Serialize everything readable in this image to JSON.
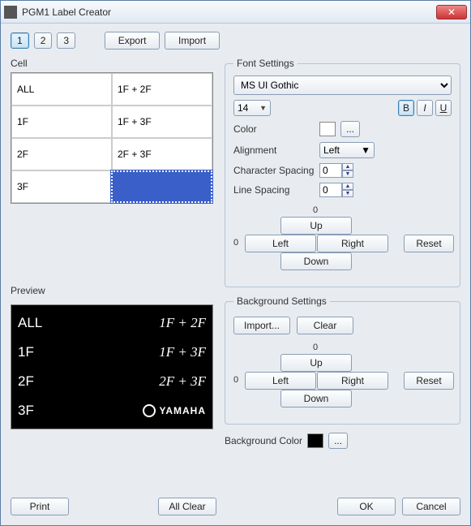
{
  "title": "PGM1 Label Creator",
  "toolbar": {
    "tabs": [
      "1",
      "2",
      "3"
    ],
    "export": "Export",
    "import": "Import"
  },
  "cell": {
    "label": "Cell",
    "rows": [
      [
        "ALL",
        "1F + 2F"
      ],
      [
        "1F",
        "1F + 3F"
      ],
      [
        "2F",
        "2F + 3F"
      ],
      [
        "3F",
        ""
      ]
    ],
    "selected": [
      3,
      1
    ]
  },
  "preview": {
    "label": "Preview",
    "rows": [
      {
        "l": "ALL",
        "r": "1F + 2F"
      },
      {
        "l": "1F",
        "r": "1F + 3F"
      },
      {
        "l": "2F",
        "r": "2F + 3F"
      },
      {
        "l": "3F",
        "r": "@YAMAHA"
      }
    ]
  },
  "font": {
    "legend": "Font Settings",
    "family": "MS UI Gothic",
    "size": "14",
    "bold": "B",
    "italic": "I",
    "underline": "U",
    "color_label": "Color",
    "ellipsis": "...",
    "align_label": "Alignment",
    "align_value": "Left",
    "charspace_label": "Character Spacing",
    "charspace_value": "0",
    "linespace_label": "Line Spacing",
    "linespace_value": "0",
    "dpad": {
      "zero": "0",
      "up": "Up",
      "left": "Left",
      "right": "Right",
      "down": "Down",
      "reset": "Reset"
    }
  },
  "bg": {
    "legend": "Background Settings",
    "import": "Import...",
    "clear": "Clear",
    "dpad": {
      "zero": "0",
      "up": "Up",
      "left": "Left",
      "right": "Right",
      "down": "Down",
      "reset": "Reset"
    },
    "color_label": "Background Color",
    "ellipsis": "..."
  },
  "footer": {
    "print": "Print",
    "allclear": "All Clear",
    "ok": "OK",
    "cancel": "Cancel"
  }
}
